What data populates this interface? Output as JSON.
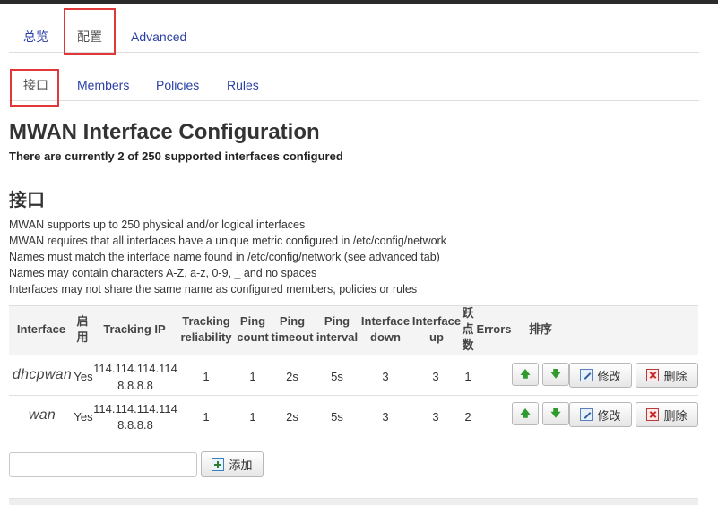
{
  "tabs_top": [
    {
      "label": "总览"
    },
    {
      "label": "配置"
    },
    {
      "label": "Advanced"
    }
  ],
  "tabs_sub": [
    {
      "label": "接口"
    },
    {
      "label": "Members"
    },
    {
      "label": "Policies"
    },
    {
      "label": "Rules"
    }
  ],
  "page": {
    "title": "MWAN Interface Configuration",
    "subtitle": "There are currently 2 of 250 supported interfaces configured",
    "section_title": "接口",
    "description": [
      "MWAN supports up to 250 physical and/or logical interfaces",
      "MWAN requires that all interfaces have a unique metric configured in /etc/config/network",
      "Names must match the interface name found in /etc/config/network (see advanced tab)",
      "Names may contain characters A-Z, a-z, 0-9, _ and no spaces",
      "Interfaces may not share the same name as configured members, policies or rules"
    ]
  },
  "table": {
    "headers": {
      "interface": "Interface",
      "enabled": "启用",
      "tracking_ip": "Tracking IP",
      "tracking_reliability": "Tracking reliability",
      "ping_count": "Ping count",
      "ping_timeout": "Ping timeout",
      "ping_interval": "Ping interval",
      "interface_down": "Interface down",
      "interface_up": "Interface up",
      "hops": "跃点数",
      "errors": "Errors",
      "sort": "排序"
    },
    "rows": [
      {
        "interface": "dhcpwan",
        "enabled": "Yes",
        "tracking_ip_1": "114.114.114.114",
        "tracking_ip_2": "8.8.8.8",
        "tracking_reliability": "1",
        "ping_count": "1",
        "ping_timeout": "2s",
        "ping_interval": "5s",
        "interface_down": "3",
        "interface_up": "3",
        "hops": "1",
        "errors": ""
      },
      {
        "interface": "wan",
        "enabled": "Yes",
        "tracking_ip_1": "114.114.114.114",
        "tracking_ip_2": "8.8.8.8",
        "tracking_reliability": "1",
        "ping_count": "1",
        "ping_timeout": "2s",
        "ping_interval": "5s",
        "interface_down": "3",
        "interface_up": "3",
        "hops": "2",
        "errors": ""
      }
    ],
    "buttons": {
      "move_up": "🡅",
      "move_down": "🡇",
      "edit": "修改",
      "delete": "删除"
    }
  },
  "add": {
    "input_value": "",
    "button_label": "添加"
  },
  "colors": {
    "link": "#2a3fa5",
    "highlight": "#e03838",
    "arrow": "#2f9b2f"
  },
  "icons": [
    "arrow-up-icon",
    "arrow-down-icon",
    "edit-icon",
    "delete-icon",
    "add-icon"
  ]
}
